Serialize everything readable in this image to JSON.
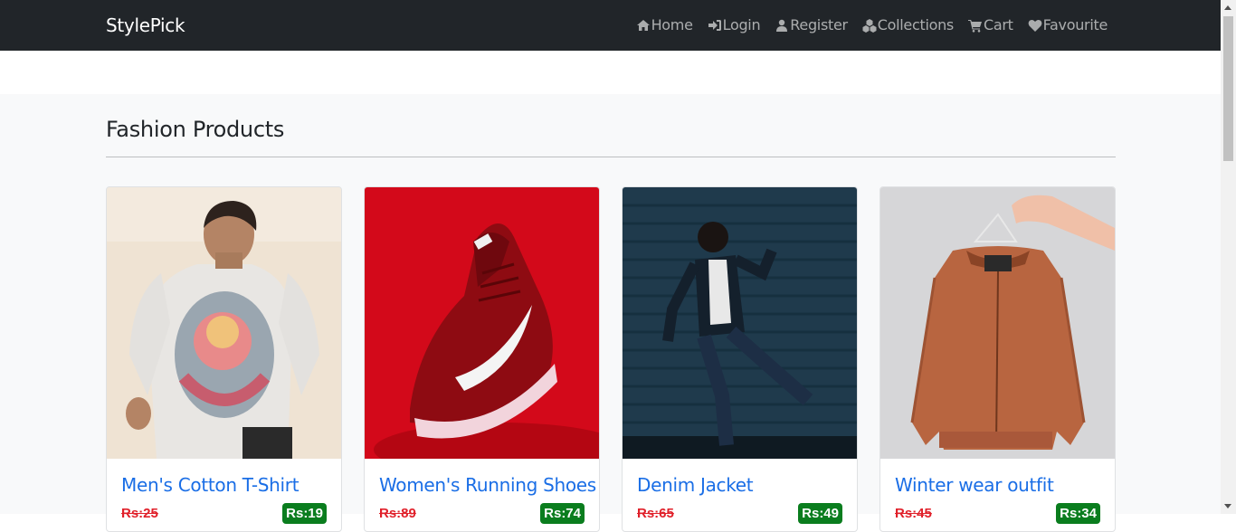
{
  "nav": {
    "brand": "StylePick",
    "links": [
      {
        "label": "Home",
        "icon": "home-icon"
      },
      {
        "label": "Login",
        "icon": "sign-in-icon"
      },
      {
        "label": "Register",
        "icon": "user-icon"
      },
      {
        "label": "Collections",
        "icon": "cubes-icon"
      },
      {
        "label": "Cart",
        "icon": "cart-icon"
      },
      {
        "label": "Favourite",
        "icon": "heart-icon"
      }
    ]
  },
  "main": {
    "title": "Fashion Products",
    "products": [
      {
        "name": "Men's Cotton T-Shirt",
        "old_price": "Rs:25",
        "new_price": "Rs:19",
        "image": "tshirt-photo"
      },
      {
        "name": "Women's Running Shoes",
        "old_price": "Rs:89",
        "new_price": "Rs:74",
        "image": "running-shoe-photo"
      },
      {
        "name": "Denim Jacket",
        "old_price": "Rs:65",
        "new_price": "Rs:49",
        "image": "denim-jacket-photo"
      },
      {
        "name": "Winter wear outfit",
        "old_price": "Rs:45",
        "new_price": "Rs:34",
        "image": "winter-jacket-photo"
      }
    ]
  },
  "colors": {
    "navbar": "#212529",
    "link": "#1a6ee6",
    "old_price": "#e0202a",
    "new_price_bg": "#0a7d1e"
  }
}
